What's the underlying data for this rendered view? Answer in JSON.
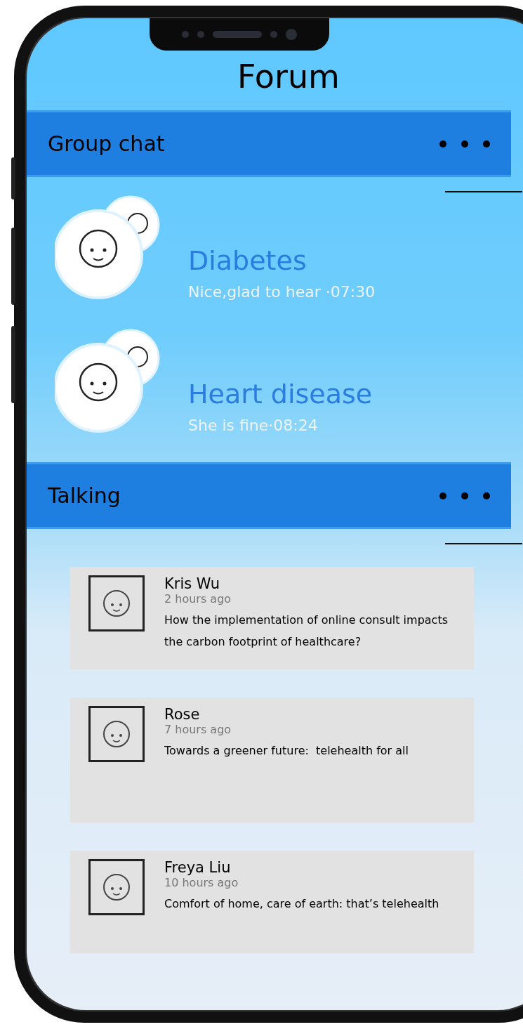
{
  "title": "Forum",
  "sections": [
    {
      "kind": "groups",
      "heading": "Group chat",
      "items": [
        {
          "name": "Diabetes",
          "preview": "Nice,glad to hear ·07:30"
        },
        {
          "name": "Heart disease",
          "preview": "She is fine·08:24"
        }
      ]
    },
    {
      "kind": "posts",
      "heading": "Talking",
      "items": [
        {
          "author": "Kris Wu",
          "time": "2 hours ago",
          "text": "How the implementation of online consult impacts the carbon footprint of healthcare?"
        },
        {
          "author": "Rose",
          "time": "7 hours ago",
          "text": "Towards a greener future:  telehealth for all"
        },
        {
          "author": "Freya Liu",
          "time": "10 hours ago",
          "text": "Comfort of home, care of earth: that’s telehealth"
        }
      ]
    }
  ]
}
